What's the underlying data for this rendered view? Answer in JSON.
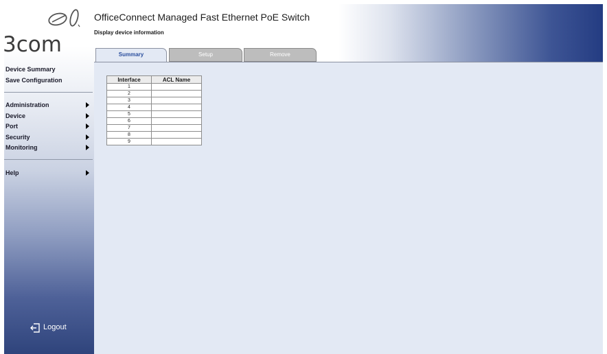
{
  "brand": {
    "logo_text": "3com"
  },
  "header": {
    "title": "OfficeConnect Managed Fast Ethernet PoE Switch",
    "subtitle": "Display device information"
  },
  "tabs": [
    {
      "label": "Summary",
      "active": true
    },
    {
      "label": "Setup",
      "active": false
    },
    {
      "label": "Remove",
      "active": false
    }
  ],
  "sidebar": {
    "top_links": [
      "Device Summary",
      "Save Configuration"
    ],
    "menus": [
      "Administration",
      "Device",
      "Port",
      "Security",
      "Monitoring"
    ],
    "help": "Help",
    "logout": "Logout"
  },
  "table": {
    "headers": [
      "Interface",
      "ACL Name"
    ],
    "rows": [
      {
        "interface": "1",
        "acl": ""
      },
      {
        "interface": "2",
        "acl": ""
      },
      {
        "interface": "3",
        "acl": ""
      },
      {
        "interface": "4",
        "acl": ""
      },
      {
        "interface": "5",
        "acl": ""
      },
      {
        "interface": "6",
        "acl": ""
      },
      {
        "interface": "7",
        "acl": ""
      },
      {
        "interface": "8",
        "acl": ""
      },
      {
        "interface": "9",
        "acl": ""
      }
    ]
  },
  "colors": {
    "content_bg": "#e3e9f4",
    "active_tab_text": "#2b4f9e",
    "header_dark": "#243c82"
  }
}
